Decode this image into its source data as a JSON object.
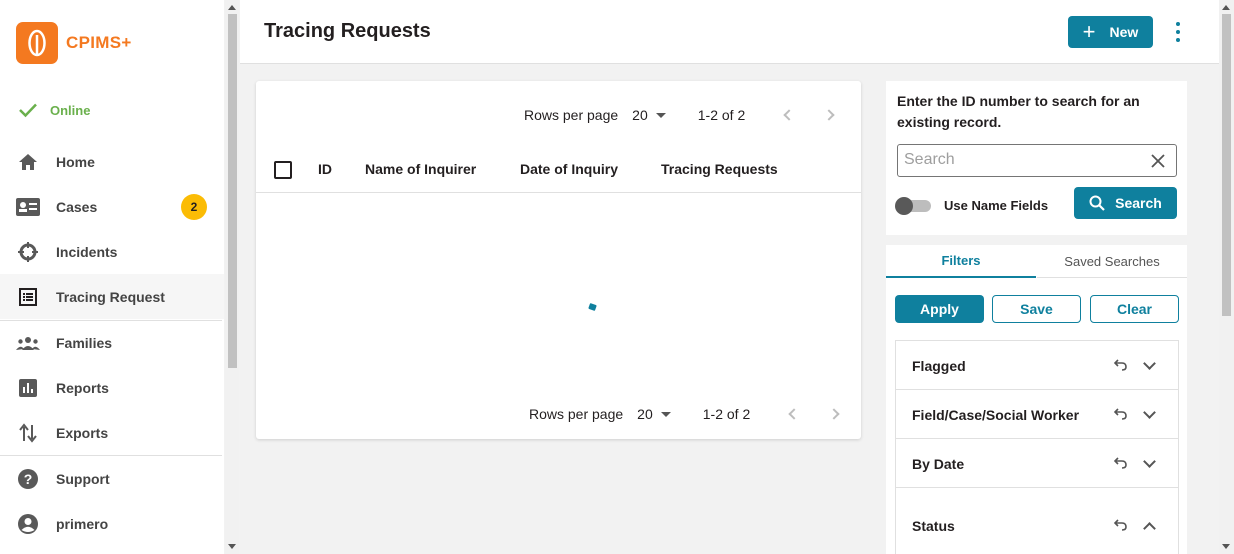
{
  "app": {
    "name": "CPIMS+"
  },
  "status": {
    "label": "Online"
  },
  "sidebar": {
    "items": [
      {
        "label": "Home"
      },
      {
        "label": "Cases",
        "badge": "2"
      },
      {
        "label": "Incidents"
      },
      {
        "label": "Tracing Request"
      },
      {
        "label": "Families"
      },
      {
        "label": "Reports"
      },
      {
        "label": "Exports"
      },
      {
        "label": "Support"
      },
      {
        "label": "primero"
      }
    ]
  },
  "header": {
    "title": "Tracing Requests",
    "new_label": "New"
  },
  "table": {
    "columns": [
      "ID",
      "Name of Inquirer",
      "Date of Inquiry",
      "Tracing Requests"
    ],
    "rows_per_page_label": "Rows per page",
    "rows_per_page": "20",
    "range": "1-2 of 2"
  },
  "search": {
    "help": "Enter the ID number to search for an existing record.",
    "placeholder": "Search",
    "toggle_label": "Use Name Fields",
    "button": "Search"
  },
  "filters": {
    "tabs": [
      "Filters",
      "Saved Searches"
    ],
    "apply": "Apply",
    "save": "Save",
    "clear": "Clear",
    "groups": [
      "Flagged",
      "Field/Case/Social Worker",
      "By Date",
      "Status"
    ]
  },
  "colors": {
    "accent": "#0f809e",
    "brand": "#f47920",
    "online": "#6ab04c",
    "badge": "#fbbc05"
  }
}
